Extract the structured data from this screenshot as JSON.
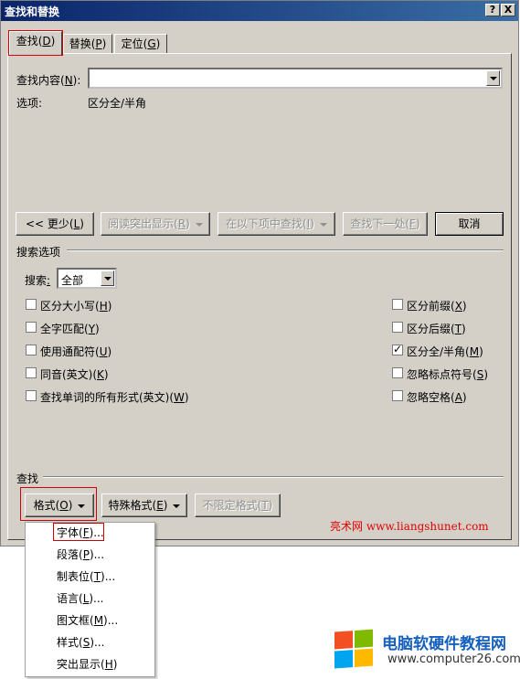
{
  "dialog": {
    "title": "查找和替换",
    "help_btn": "?",
    "close_btn": "X"
  },
  "tabs": [
    {
      "label": "查找(D)",
      "pre": "查找(",
      "key": "D",
      "post": ")"
    },
    {
      "label": "替换(P)",
      "pre": "替换(",
      "key": "P",
      "post": ")"
    },
    {
      "label": "定位(G)",
      "pre": "定位(",
      "key": "G",
      "post": ")"
    }
  ],
  "find": {
    "label_pre": "查找内容(",
    "label_key": "N",
    "label_post": "):",
    "value": "",
    "options_label": "选项:",
    "options_value": "区分全/半角"
  },
  "buttons": {
    "less": {
      "pre": "<< 更少(",
      "key": "L",
      "post": ")"
    },
    "reading_highlight": {
      "pre": "阅读突出显示(",
      "key": "R",
      "post": ")"
    },
    "find_in": {
      "pre": "在以下项中查找(",
      "key": "I",
      "post": ")"
    },
    "find_next": {
      "pre": "查找下一处(",
      "key": "F",
      "post": ")"
    },
    "cancel": "取消"
  },
  "search_options": {
    "section_label": "搜索选项",
    "search_label_pre": "搜索",
    "search_label_key": "",
    "search_value": "全部",
    "left": [
      {
        "pre": "区分大小写(",
        "key": "H",
        "post": ")",
        "checked": false
      },
      {
        "pre": "全字匹配(",
        "key": "Y",
        "post": ")",
        "checked": false
      },
      {
        "pre": "使用通配符(",
        "key": "U",
        "post": ")",
        "checked": false
      },
      {
        "pre": "同音(英文)(",
        "key": "K",
        "post": ")",
        "checked": false
      },
      {
        "pre": "查找单词的所有形式(英文)(",
        "key": "W",
        "post": ")",
        "checked": false
      }
    ],
    "right": [
      {
        "pre": "区分前缀(",
        "key": "X",
        "post": ")",
        "checked": false
      },
      {
        "pre": "区分后缀(",
        "key": "T",
        "post": ")",
        "checked": false
      },
      {
        "pre": "区分全/半角(",
        "key": "M",
        "post": ")",
        "checked": true
      },
      {
        "pre": "忽略标点符号(",
        "key": "S",
        "post": ")",
        "checked": false
      },
      {
        "pre": "忽略空格(",
        "key": "A",
        "post": ")",
        "checked": false
      }
    ]
  },
  "find_section": {
    "label": "查找",
    "format_btn": {
      "pre": "格式(",
      "key": "O",
      "post": ")"
    },
    "special_btn": {
      "pre": "特殊格式(",
      "key": "E",
      "post": ")"
    },
    "no_format_btn": {
      "pre": "不限定格式(",
      "key": "T",
      "post": ")"
    }
  },
  "format_menu": [
    {
      "pre": "字体(",
      "key": "F",
      "post": ")..."
    },
    {
      "pre": "段落(",
      "key": "P",
      "post": ")..."
    },
    {
      "pre": "制表位(",
      "key": "T",
      "post": ")..."
    },
    {
      "pre": "语言(",
      "key": "L",
      "post": ")..."
    },
    {
      "pre": "图文框(",
      "key": "M",
      "post": ")..."
    },
    {
      "pre": "样式(",
      "key": "S",
      "post": ")..."
    },
    {
      "pre": "突出显示(",
      "key": "H",
      "post": ")"
    }
  ],
  "watermarks": {
    "site1": "亮术网 www.liangshunet.com",
    "site2_title": "电脑软硬件教程网",
    "site2_url": "www.computer26.com"
  },
  "colors": {
    "dialog_bg": "#d4d0c8",
    "titlebar": "#0a246a",
    "highlight_red": "#d00000",
    "logo_red": "#f25022",
    "logo_green": "#7fba00",
    "logo_blue": "#00a4ef",
    "logo_yellow": "#ffb900",
    "site2_blue": "#1560bd"
  }
}
